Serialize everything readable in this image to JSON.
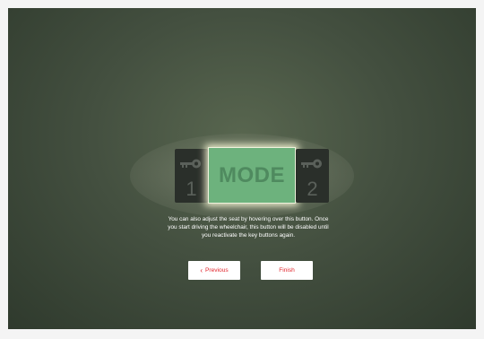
{
  "overlay": {
    "mode_label": "MODE",
    "left_button_number": "1",
    "right_button_number": "2",
    "left_icon": "key-icon",
    "right_icon": "key-icon",
    "message": "You can also adjust the seat by hovering over this button. Once you start driving the wheelchair, this button will be disabled until you reactivate the key buttons again.",
    "previous_label": "Previous",
    "previous_icon": "chevron-left-icon",
    "finish_label": "Finish"
  },
  "colors": {
    "accent": "#e2262d",
    "mode_highlight": "#6db27d"
  }
}
